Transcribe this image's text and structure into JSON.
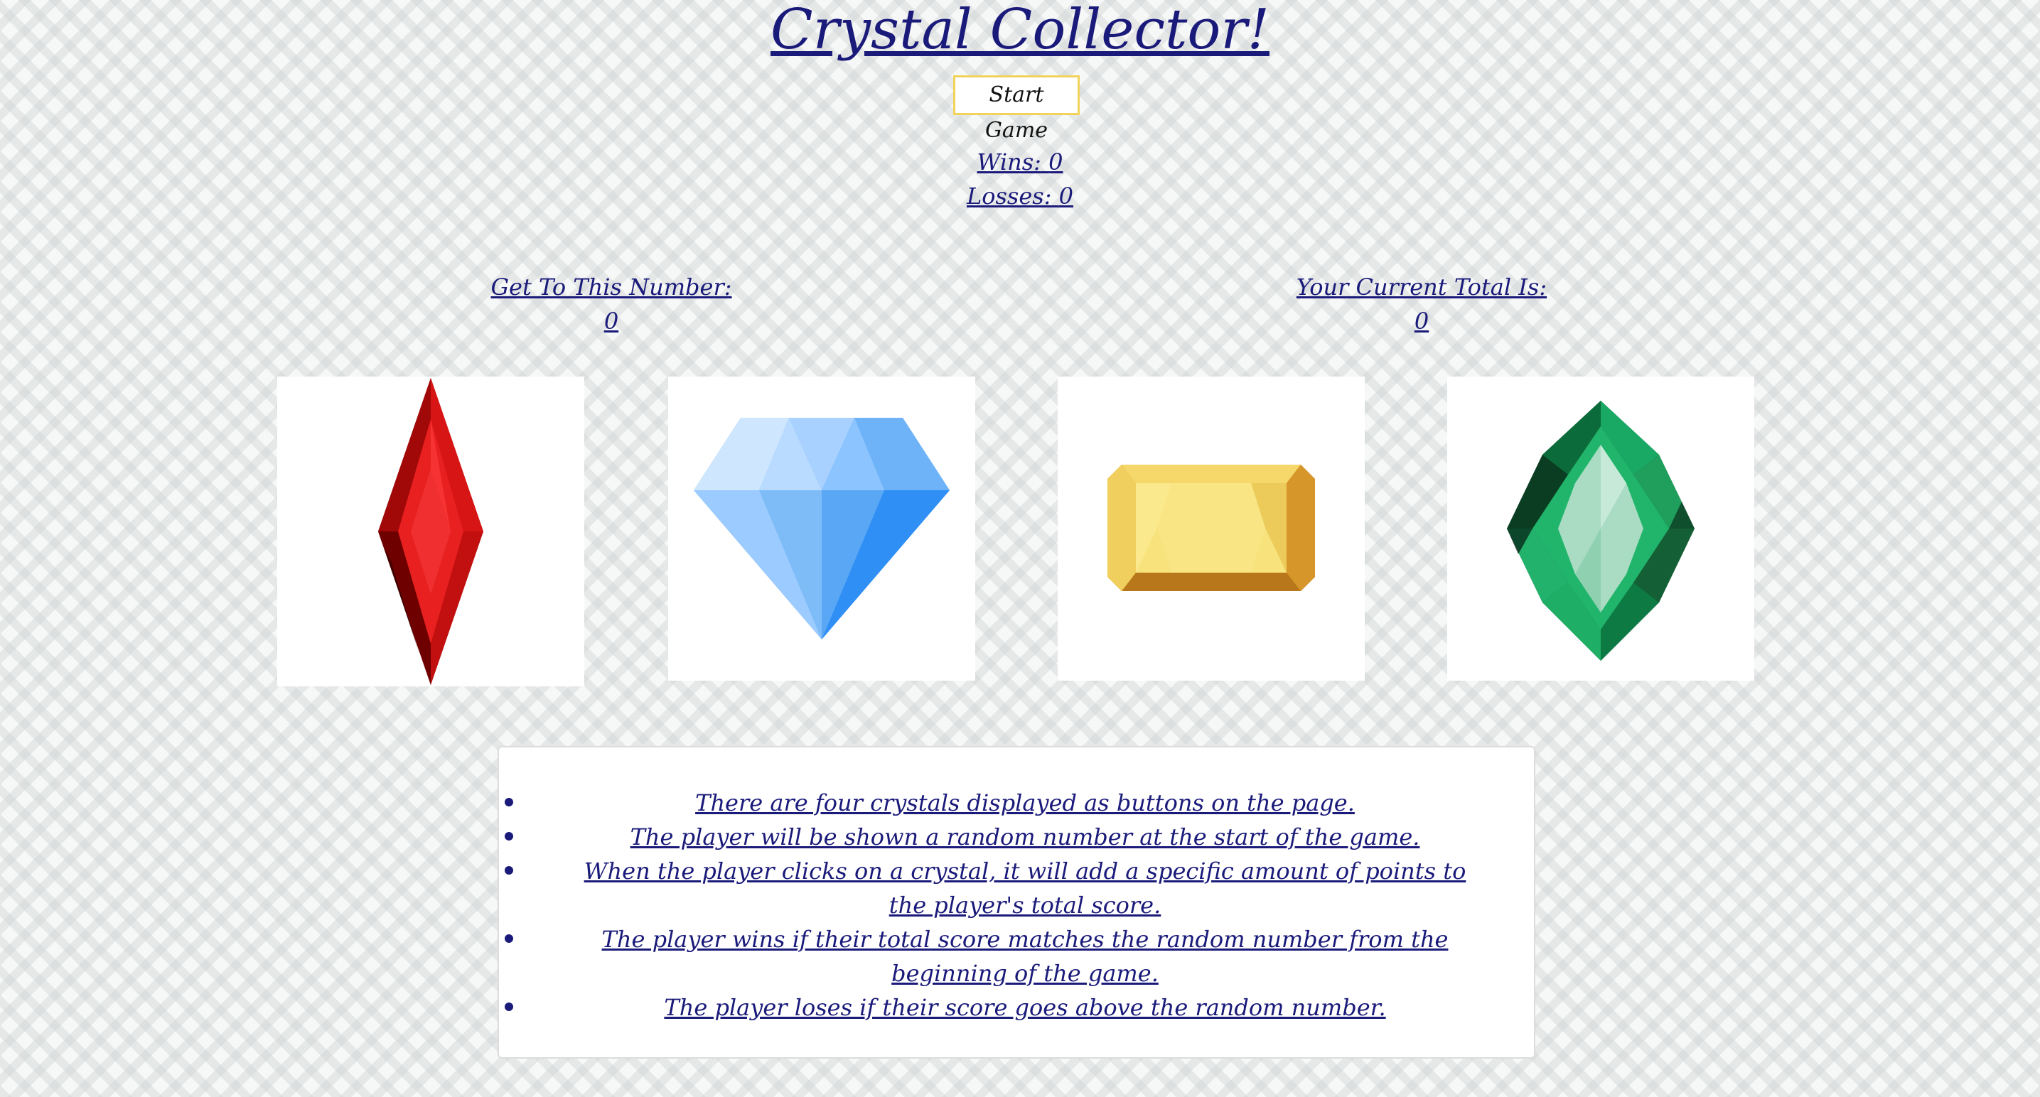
{
  "title": "Crystal Collector!",
  "start_button_label": "Start Game",
  "score": {
    "wins_label": "Wins:",
    "wins_value": "0",
    "losses_label": "Losses:",
    "losses_value": "0"
  },
  "target": {
    "label": "Get To This Number:",
    "value": "0"
  },
  "current_total": {
    "label": "Your Current Total Is:",
    "value": "0"
  },
  "crystals": [
    {
      "name": "red-crystal-icon",
      "color": "#cc1111"
    },
    {
      "name": "blue-diamond-icon",
      "color": "#4aa3ff"
    },
    {
      "name": "yellow-crystal-icon",
      "color": "#f2c94c"
    },
    {
      "name": "green-emerald-icon",
      "color": "#1aa865"
    }
  ],
  "rules": [
    "There are four crystals displayed as buttons on the page.",
    "The player will be shown a random number at the start of the game.",
    "When the player clicks on a crystal, it will add a specific amount of points to the player's total score.",
    "The player wins if their total score matches the random number from the beginning of the game.",
    "The player loses if their score goes above the random number."
  ]
}
